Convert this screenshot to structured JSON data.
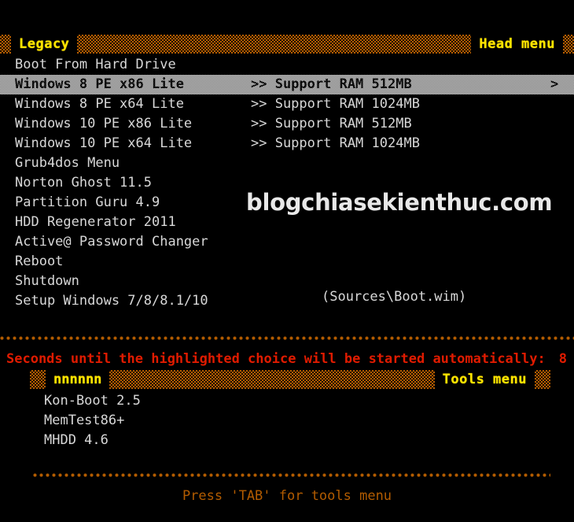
{
  "head_menu": {
    "title": "Legacy",
    "right_label": "Head menu",
    "items": [
      {
        "name": "Boot From Hard Drive",
        "desc": "",
        "arrow": "",
        "selected": false
      },
      {
        "name": "Windows 8 PE x86 Lite",
        "desc": ">> Support RAM 512MB",
        "arrow": ">",
        "selected": true
      },
      {
        "name": "Windows 8 PE x64 Lite",
        "desc": ">> Support RAM 1024MB",
        "arrow": "",
        "selected": false
      },
      {
        "name": "Windows 10 PE x86  Lite",
        "desc": ">> Support RAM 512MB",
        "arrow": "",
        "selected": false
      },
      {
        "name": "Windows 10 PE x64  Lite",
        "desc": ">> Support RAM 1024MB",
        "arrow": "",
        "selected": false
      },
      {
        "name": "Grub4dos Menu",
        "desc": "",
        "arrow": "",
        "selected": false
      },
      {
        "name": "Norton Ghost 11.5",
        "desc": "",
        "arrow": "",
        "selected": false
      },
      {
        "name": "Partition Guru 4.9",
        "desc": "",
        "arrow": "",
        "selected": false
      },
      {
        "name": "HDD Regenerator 2011",
        "desc": "",
        "arrow": "",
        "selected": false
      },
      {
        "name": "Active@ Password Changer",
        "desc": "",
        "arrow": "",
        "selected": false
      },
      {
        "name": "Reboot",
        "desc": "",
        "arrow": "",
        "selected": false
      },
      {
        "name": "Shutdown",
        "desc": "",
        "arrow": "",
        "selected": false
      },
      {
        "name": "Setup Windows 7/8/8.1/10",
        "desc": "",
        "arrow": "",
        "selected": false
      }
    ]
  },
  "boot_wim_note": "(Sources\\Boot.wim)",
  "watermark": "blogchiasekienthuc.com",
  "countdown": {
    "message": "Seconds until the highlighted choice will be started automatically:",
    "seconds": "8"
  },
  "tools_menu": {
    "title": "nnnnnn",
    "right_label": "Tools menu",
    "items": [
      {
        "name": "Kon-Boot 2.5"
      },
      {
        "name": "MemTest86+"
      },
      {
        "name": "MHDD 4.6"
      }
    ]
  },
  "footer_hint": "Press 'TAB' for tools menu",
  "colors": {
    "background": "#000000",
    "accent_orange": "#b35c00",
    "accent_yellow": "#ffe400",
    "countdown_red": "#e01b00",
    "text_gray": "#d8d8d8",
    "selection_gray": "#cfcfcf"
  }
}
